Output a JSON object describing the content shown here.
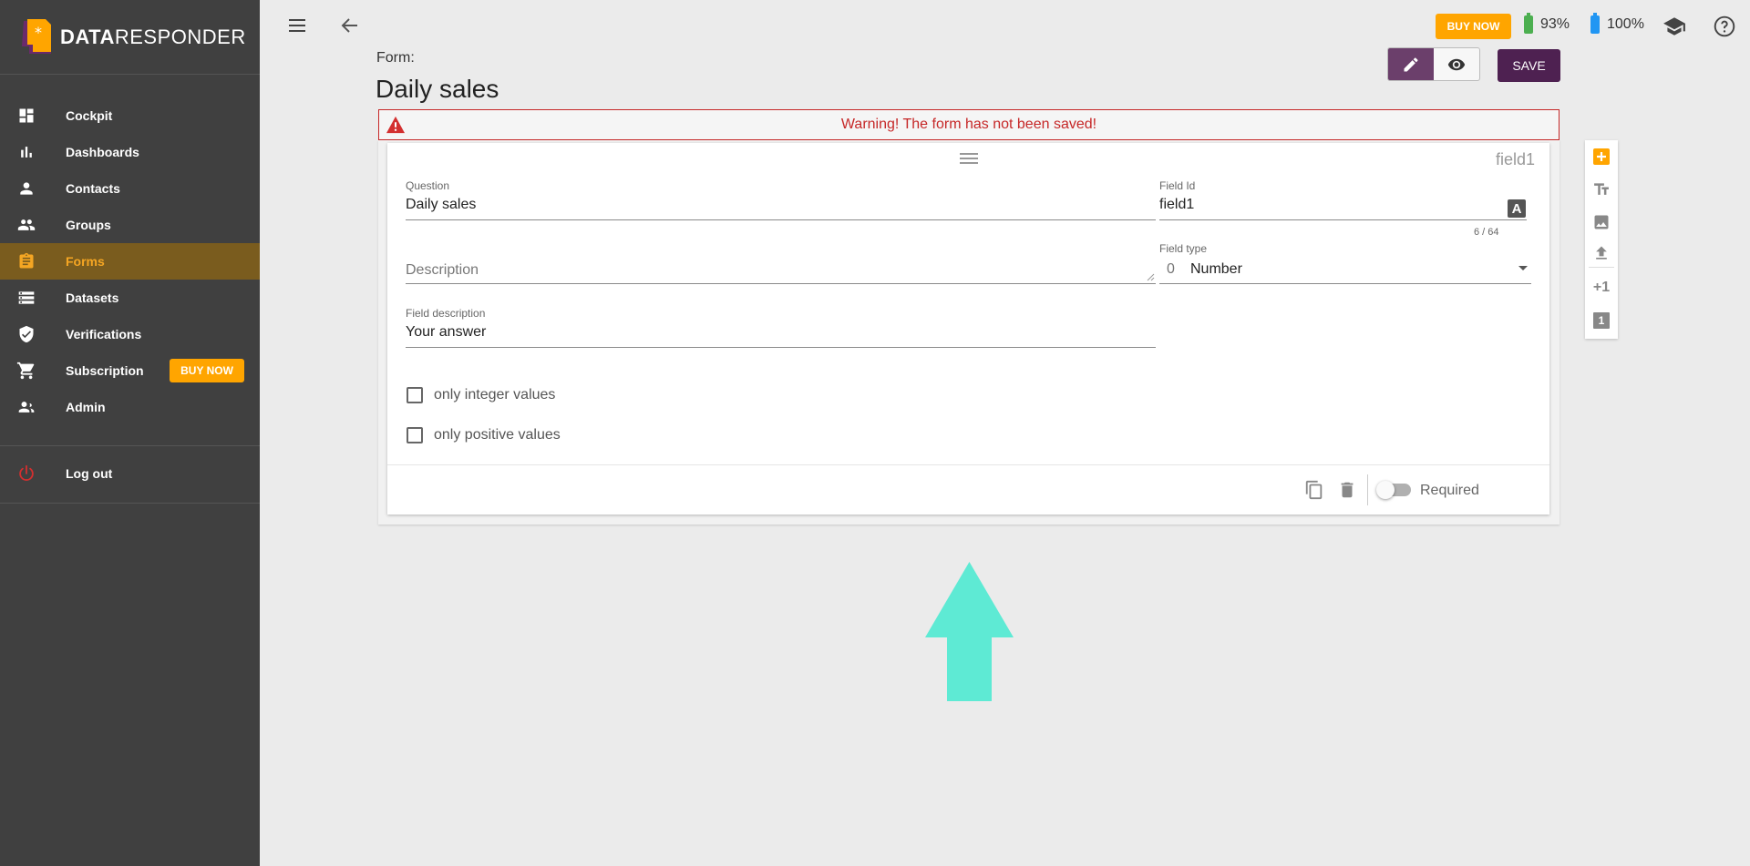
{
  "brand": {
    "name_bold": "DATA",
    "name_light": "RESPONDER"
  },
  "sidebar": {
    "items": [
      {
        "label": "Cockpit",
        "icon": "dashboard-icon"
      },
      {
        "label": "Dashboards",
        "icon": "bar-chart-icon"
      },
      {
        "label": "Contacts",
        "icon": "person-icon"
      },
      {
        "label": "Groups",
        "icon": "people-icon"
      },
      {
        "label": "Forms",
        "icon": "clipboard-icon",
        "active": true
      },
      {
        "label": "Datasets",
        "icon": "list-icon"
      },
      {
        "label": "Verifications",
        "icon": "shield-check-icon"
      },
      {
        "label": "Subscription",
        "icon": "cart-icon",
        "badge": "BUY NOW"
      },
      {
        "label": "Admin",
        "icon": "admin-icon"
      }
    ],
    "logout": "Log out"
  },
  "topbar": {
    "buy_now": "BUY NOW",
    "battery1": "93%",
    "battery2": "100%"
  },
  "header": {
    "form_label": "Form:",
    "title": "Daily sales",
    "save": "SAVE"
  },
  "warning": "Warning! The form has not been saved!",
  "field": {
    "tag": "field1",
    "question_label": "Question",
    "question_value": "Daily sales",
    "field_id_label": "Field Id",
    "field_id_value": "field1",
    "field_id_counter": "6 / 64",
    "field_id_icon": "A",
    "description_placeholder": "Description",
    "field_type_label": "Field type",
    "field_type_prefix": "0",
    "field_type_value": "Number",
    "field_description_label": "Field description",
    "field_description_value": "Your answer",
    "checkbox_integer": "only integer values",
    "checkbox_positive": "only positive values",
    "required_label": "Required"
  },
  "toolbar": {
    "plus_one": "+1",
    "one": "1"
  },
  "colors": {
    "sidebar_bg": "#404040",
    "accent": "#ffa500",
    "save_bg": "#4e2151",
    "warning": "#c62828",
    "arrow": "#5eead4"
  }
}
